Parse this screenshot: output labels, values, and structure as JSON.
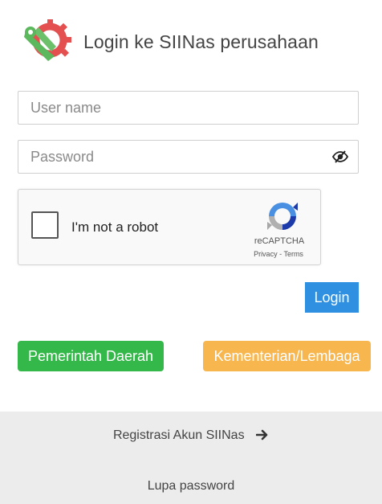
{
  "header": {
    "title": "Login ke SIINas perusahaan",
    "logo_icon": "siinas-gear-logo"
  },
  "form": {
    "username_placeholder": "User name",
    "username_value": "",
    "password_placeholder": "Password",
    "password_value": "",
    "toggle_icon": "eye-slash-icon"
  },
  "captcha": {
    "label": "I'm not a robot",
    "brand": "reCAPTCHA",
    "privacy": "Privacy",
    "separator": "-",
    "terms": "Terms"
  },
  "buttons": {
    "login": "Login",
    "pemda": "Pemerintah Daerah",
    "kl": "Kementerian/Lembaga"
  },
  "footer": {
    "register": "Registrasi Akun SIINas",
    "register_icon": "arrow-right-icon",
    "forgot": "Lupa password"
  },
  "colors": {
    "login_button": "#2f8fe0",
    "pemda_button": "#34b84a",
    "kl_button": "#f8b64f",
    "footer_bg": "#ececec"
  }
}
